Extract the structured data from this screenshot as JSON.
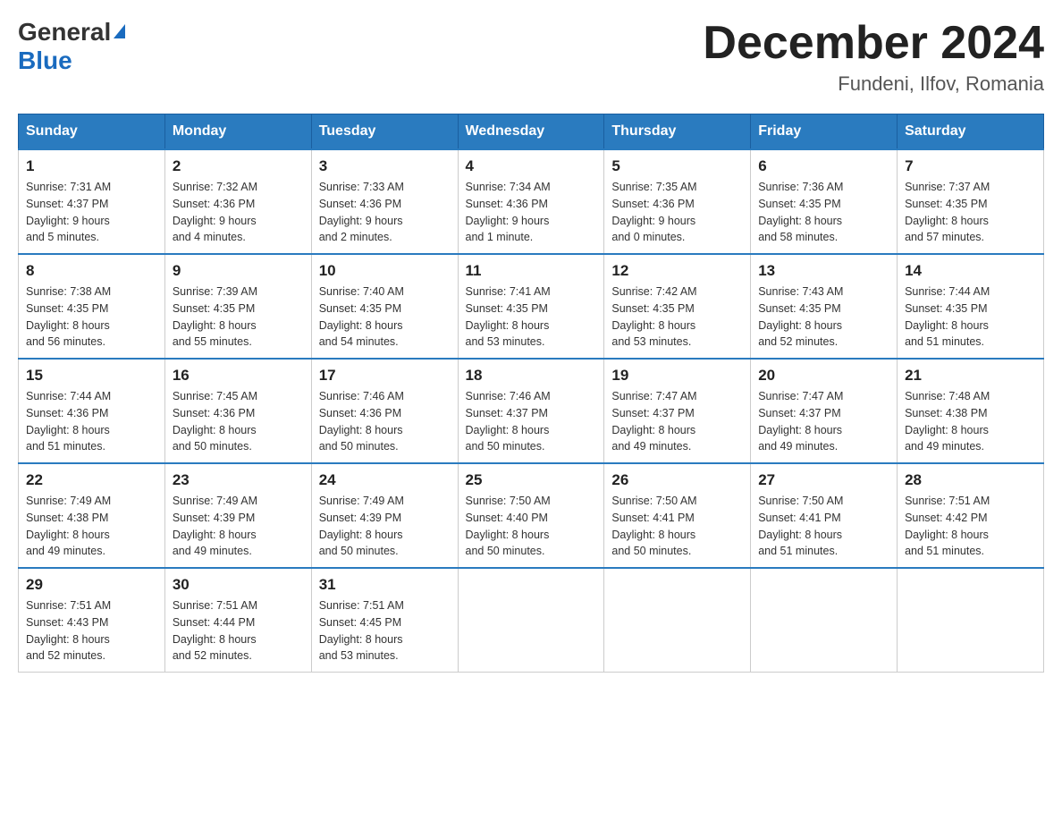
{
  "header": {
    "logo": {
      "general": "General",
      "arrow": "▶",
      "blue": "Blue"
    },
    "title": "December 2024",
    "location": "Fundeni, Ilfov, Romania"
  },
  "weekdays": [
    "Sunday",
    "Monday",
    "Tuesday",
    "Wednesday",
    "Thursday",
    "Friday",
    "Saturday"
  ],
  "weeks": [
    [
      {
        "day": "1",
        "sunrise": "7:31 AM",
        "sunset": "4:37 PM",
        "daylight": "9 hours and 5 minutes."
      },
      {
        "day": "2",
        "sunrise": "7:32 AM",
        "sunset": "4:36 PM",
        "daylight": "9 hours and 4 minutes."
      },
      {
        "day": "3",
        "sunrise": "7:33 AM",
        "sunset": "4:36 PM",
        "daylight": "9 hours and 2 minutes."
      },
      {
        "day": "4",
        "sunrise": "7:34 AM",
        "sunset": "4:36 PM",
        "daylight": "9 hours and 1 minute."
      },
      {
        "day": "5",
        "sunrise": "7:35 AM",
        "sunset": "4:36 PM",
        "daylight": "9 hours and 0 minutes."
      },
      {
        "day": "6",
        "sunrise": "7:36 AM",
        "sunset": "4:35 PM",
        "daylight": "8 hours and 58 minutes."
      },
      {
        "day": "7",
        "sunrise": "7:37 AM",
        "sunset": "4:35 PM",
        "daylight": "8 hours and 57 minutes."
      }
    ],
    [
      {
        "day": "8",
        "sunrise": "7:38 AM",
        "sunset": "4:35 PM",
        "daylight": "8 hours and 56 minutes."
      },
      {
        "day": "9",
        "sunrise": "7:39 AM",
        "sunset": "4:35 PM",
        "daylight": "8 hours and 55 minutes."
      },
      {
        "day": "10",
        "sunrise": "7:40 AM",
        "sunset": "4:35 PM",
        "daylight": "8 hours and 54 minutes."
      },
      {
        "day": "11",
        "sunrise": "7:41 AM",
        "sunset": "4:35 PM",
        "daylight": "8 hours and 53 minutes."
      },
      {
        "day": "12",
        "sunrise": "7:42 AM",
        "sunset": "4:35 PM",
        "daylight": "8 hours and 53 minutes."
      },
      {
        "day": "13",
        "sunrise": "7:43 AM",
        "sunset": "4:35 PM",
        "daylight": "8 hours and 52 minutes."
      },
      {
        "day": "14",
        "sunrise": "7:44 AM",
        "sunset": "4:35 PM",
        "daylight": "8 hours and 51 minutes."
      }
    ],
    [
      {
        "day": "15",
        "sunrise": "7:44 AM",
        "sunset": "4:36 PM",
        "daylight": "8 hours and 51 minutes."
      },
      {
        "day": "16",
        "sunrise": "7:45 AM",
        "sunset": "4:36 PM",
        "daylight": "8 hours and 50 minutes."
      },
      {
        "day": "17",
        "sunrise": "7:46 AM",
        "sunset": "4:36 PM",
        "daylight": "8 hours and 50 minutes."
      },
      {
        "day": "18",
        "sunrise": "7:46 AM",
        "sunset": "4:37 PM",
        "daylight": "8 hours and 50 minutes."
      },
      {
        "day": "19",
        "sunrise": "7:47 AM",
        "sunset": "4:37 PM",
        "daylight": "8 hours and 49 minutes."
      },
      {
        "day": "20",
        "sunrise": "7:47 AM",
        "sunset": "4:37 PM",
        "daylight": "8 hours and 49 minutes."
      },
      {
        "day": "21",
        "sunrise": "7:48 AM",
        "sunset": "4:38 PM",
        "daylight": "8 hours and 49 minutes."
      }
    ],
    [
      {
        "day": "22",
        "sunrise": "7:49 AM",
        "sunset": "4:38 PM",
        "daylight": "8 hours and 49 minutes."
      },
      {
        "day": "23",
        "sunrise": "7:49 AM",
        "sunset": "4:39 PM",
        "daylight": "8 hours and 49 minutes."
      },
      {
        "day": "24",
        "sunrise": "7:49 AM",
        "sunset": "4:39 PM",
        "daylight": "8 hours and 50 minutes."
      },
      {
        "day": "25",
        "sunrise": "7:50 AM",
        "sunset": "4:40 PM",
        "daylight": "8 hours and 50 minutes."
      },
      {
        "day": "26",
        "sunrise": "7:50 AM",
        "sunset": "4:41 PM",
        "daylight": "8 hours and 50 minutes."
      },
      {
        "day": "27",
        "sunrise": "7:50 AM",
        "sunset": "4:41 PM",
        "daylight": "8 hours and 51 minutes."
      },
      {
        "day": "28",
        "sunrise": "7:51 AM",
        "sunset": "4:42 PM",
        "daylight": "8 hours and 51 minutes."
      }
    ],
    [
      {
        "day": "29",
        "sunrise": "7:51 AM",
        "sunset": "4:43 PM",
        "daylight": "8 hours and 52 minutes."
      },
      {
        "day": "30",
        "sunrise": "7:51 AM",
        "sunset": "4:44 PM",
        "daylight": "8 hours and 52 minutes."
      },
      {
        "day": "31",
        "sunrise": "7:51 AM",
        "sunset": "4:45 PM",
        "daylight": "8 hours and 53 minutes."
      },
      null,
      null,
      null,
      null
    ]
  ],
  "labels": {
    "sunrise": "Sunrise:",
    "sunset": "Sunset:",
    "daylight": "Daylight:"
  }
}
